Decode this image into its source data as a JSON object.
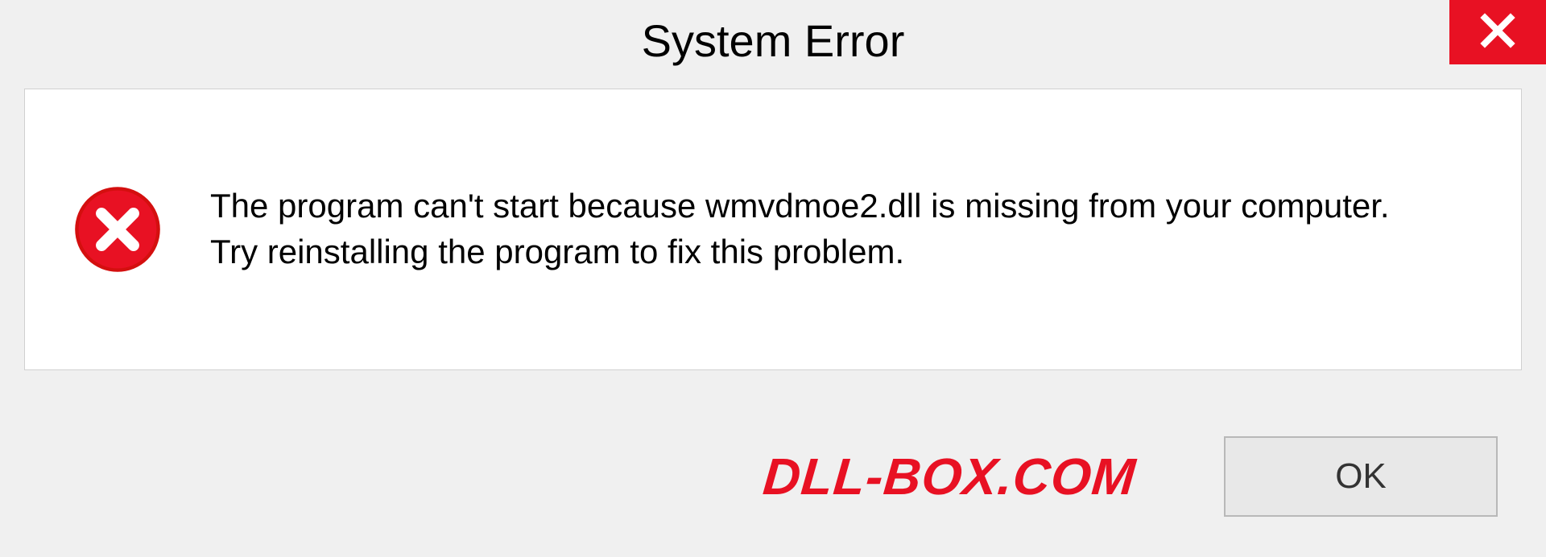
{
  "title": "System Error",
  "message": "The program can't start because wmvdmoe2.dll is missing from your computer.\nTry reinstalling the program to fix this problem.",
  "watermark": "DLL-BOX.COM",
  "ok_label": "OK",
  "colors": {
    "accent_red": "#e81123",
    "panel_bg": "#ffffff",
    "dialog_bg": "#f0f0f0"
  }
}
